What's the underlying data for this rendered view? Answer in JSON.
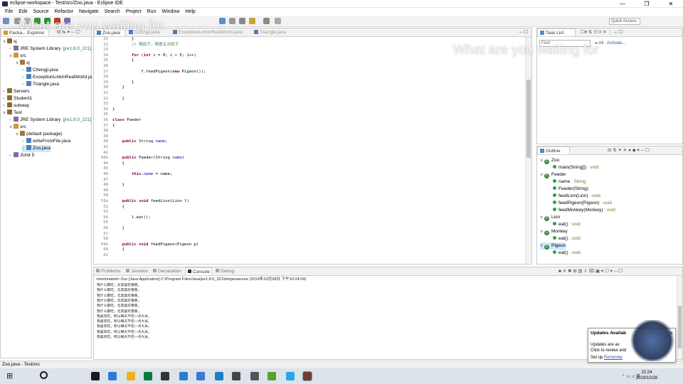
{
  "window": {
    "title": "eclipse-workspace - Test/src/Zoo.java - Eclipse IDE",
    "min": "—",
    "max": "❐",
    "close": "✕"
  },
  "menu": [
    "File",
    "Edit",
    "Source",
    "Refactor",
    "Navigate",
    "Search",
    "Project",
    "Run",
    "Window",
    "Help"
  ],
  "toolbar": {
    "quick_access": "Quick Access"
  },
  "package_explorer": {
    "tab_label": "Packa... Explorer",
    "rows": [
      {
        "indent": 0,
        "twisty": "∨",
        "icon": "project-icon",
        "label": "sj",
        "color": "#8a6d2e"
      },
      {
        "indent": 1,
        "twisty": "›",
        "icon": "library-icon",
        "label": "JRE System Library",
        "deco": "[jre1.8.0_221]",
        "color": "#7d6da8"
      },
      {
        "indent": 1,
        "twisty": "∨",
        "icon": "source-folder-icon",
        "label": "src",
        "color": "#c79a3a"
      },
      {
        "indent": 2,
        "twisty": "∨",
        "icon": "package-icon",
        "label": "sj",
        "color": "#a5763a"
      },
      {
        "indent": 3,
        "twisty": "›",
        "icon": "java-file-icon",
        "label": "Chengji.java",
        "color": "#4a7fbf"
      },
      {
        "indent": 3,
        "twisty": "›",
        "icon": "java-file-icon",
        "label": "ExceptionLinkInRealWorld.ja",
        "color": "#4a7fbf"
      },
      {
        "indent": 3,
        "twisty": "›",
        "icon": "java-file-icon",
        "label": "Triangle.java",
        "color": "#4a7fbf"
      },
      {
        "indent": 0,
        "twisty": "›",
        "icon": "project-icon",
        "label": "Servers",
        "color": "#8a6d2e"
      },
      {
        "indent": 0,
        "twisty": "›",
        "icon": "project-icon",
        "label": "Student1",
        "color": "#8a6d2e"
      },
      {
        "indent": 0,
        "twisty": "›",
        "icon": "project-icon",
        "label": "subway",
        "color": "#8a6d2e"
      },
      {
        "indent": 0,
        "twisty": "∨",
        "icon": "project-icon",
        "label": "Test",
        "color": "#8a6d2e"
      },
      {
        "indent": 1,
        "twisty": "›",
        "icon": "library-icon",
        "label": "JRE System Library",
        "deco": "[jre1.8.0_221]",
        "color": "#7d6da8"
      },
      {
        "indent": 1,
        "twisty": "∨",
        "icon": "source-folder-icon",
        "label": "src",
        "color": "#c79a3a"
      },
      {
        "indent": 2,
        "twisty": "∨",
        "icon": "package-icon",
        "label": "(default package)",
        "color": "#a5763a"
      },
      {
        "indent": 3,
        "twisty": "›",
        "icon": "java-file-icon",
        "label": "writeFromFile.java",
        "color": "#4a7fbf"
      },
      {
        "indent": 3,
        "twisty": "›",
        "icon": "java-file-icon",
        "label": "Zoo.java",
        "color": "#4a7fbf",
        "selected": true
      },
      {
        "indent": 1,
        "twisty": "›",
        "icon": "library-icon",
        "label": "JUnit 5",
        "color": "#7d6da8"
      }
    ]
  },
  "editor": {
    "tabs": [
      {
        "label": "Zoo.java",
        "active": true
      },
      {
        "label": "Chengji.java"
      },
      {
        "label": "ExceptionLinkInRealWorld.java"
      },
      {
        "label": "Triangle.java"
      }
    ],
    "lines": [
      {
        "n": "21",
        "t": "        }"
      },
      {
        "n": "22",
        "t": "        // 喂鸽子，喂食五次鸽子"
      },
      {
        "n": "23",
        "t": ""
      },
      {
        "n": "24",
        "t": "        for (int i = 0; i < 5; i++)"
      },
      {
        "n": "25",
        "t": "        {"
      },
      {
        "n": "26",
        "t": ""
      },
      {
        "n": "27",
        "t": "            f.feedPigeon(new Pigeon());"
      },
      {
        "n": "28",
        "t": ""
      },
      {
        "n": "29",
        "t": "        }"
      },
      {
        "n": "30",
        "t": "    }"
      },
      {
        "n": "31",
        "t": ""
      },
      {
        "n": "32",
        "t": "    }"
      },
      {
        "n": "33",
        "t": ""
      },
      {
        "n": "34",
        "t": "}"
      },
      {
        "n": "35",
        "t": ""
      },
      {
        "n": "36",
        "t": "class Feeder"
      },
      {
        "n": "37",
        "t": "{"
      },
      {
        "n": "38",
        "t": ""
      },
      {
        "n": "39",
        "t": ""
      },
      {
        "n": "40",
        "t": "    public String name;"
      },
      {
        "n": "41",
        "t": ""
      },
      {
        "n": "42",
        "t": ""
      },
      {
        "n": "43⊖",
        "t": "    public Feeder(String name)"
      },
      {
        "n": "44",
        "t": "    {"
      },
      {
        "n": "45",
        "t": ""
      },
      {
        "n": "46",
        "t": "        this.name = name;"
      },
      {
        "n": "47",
        "t": ""
      },
      {
        "n": "48",
        "t": "    }"
      },
      {
        "n": "49",
        "t": ""
      },
      {
        "n": "50",
        "t": ""
      },
      {
        "n": "51⊖",
        "t": "    public void feedLion(Lion l)"
      },
      {
        "n": "52",
        "t": "    {"
      },
      {
        "n": "53",
        "t": ""
      },
      {
        "n": "54",
        "t": "        l.eat();"
      },
      {
        "n": "55",
        "t": ""
      },
      {
        "n": "56",
        "t": "    }"
      },
      {
        "n": "57",
        "t": ""
      },
      {
        "n": "58",
        "t": ""
      },
      {
        "n": "59⊖",
        "t": "    public void feedPigeon(Pigeon p)"
      },
      {
        "n": "60",
        "t": "    {"
      },
      {
        "n": "61",
        "t": ""
      }
    ]
  },
  "task_list": {
    "tab_label": "Task List",
    "find_placeholder": "Find",
    "all_label": "All",
    "activate_label": "Activate..."
  },
  "outline": {
    "tab_label": "Outline",
    "rows": [
      {
        "indent": 0,
        "kind": "class",
        "label": "Zoo"
      },
      {
        "indent": 1,
        "kind": "method",
        "label": "main(String[])",
        "type": " : void"
      },
      {
        "indent": 0,
        "kind": "class",
        "label": "Feeder"
      },
      {
        "indent": 1,
        "kind": "field",
        "label": "name",
        "type": " : String"
      },
      {
        "indent": 1,
        "kind": "method",
        "label": "Feeder(String)",
        "type": ""
      },
      {
        "indent": 1,
        "kind": "method",
        "label": "feedLion(Lion)",
        "type": " : void"
      },
      {
        "indent": 1,
        "kind": "method",
        "label": "feedPigeon(Pigeon)",
        "type": " : void"
      },
      {
        "indent": 1,
        "kind": "method",
        "label": "feedMonkey(Monkey)",
        "type": " : void"
      },
      {
        "indent": 0,
        "kind": "class",
        "label": "Lion"
      },
      {
        "indent": 1,
        "kind": "method",
        "label": "eat()",
        "type": " : void"
      },
      {
        "indent": 0,
        "kind": "class",
        "label": "Monkey"
      },
      {
        "indent": 1,
        "kind": "method",
        "label": "eat()",
        "type": " : void"
      },
      {
        "indent": 0,
        "kind": "class",
        "label": "Pigeon",
        "selected": true
      },
      {
        "indent": 1,
        "kind": "method",
        "label": "eat()",
        "type": " : void"
      }
    ]
  },
  "bottom_tabs": [
    "Problems",
    "Javadoc",
    "Declaration",
    "Console",
    "Debug"
  ],
  "console": {
    "header": "<terminated> Zoo [Java Application] C:\\Program Files\\Java\\jre1.8.0_221\\bin\\javaw.exe (2019年10月28日 下午10:24:04)",
    "lines": [
      "我什么都吃，尤其喜欢香蕉。",
      "我什么都吃，尤其喜欢香蕉。",
      "我什么都吃，尤其喜欢香蕉。",
      "我什么都吃，尤其喜欢香蕉。",
      "我什么都吃，尤其喜欢香蕉。",
      "我什么都吃，尤其喜欢香蕉。",
      "我喜欢吃，所以每天不吃一点大米。",
      "我喜欢吃，所以每天不吃一点大米。",
      "我喜欢吃，所以每天不吃一点大米。",
      "我喜欢吃，所以每天不吃一点大米。",
      "我喜欢吃，所以每天不吃一点大米。"
    ]
  },
  "status": {
    "text": "Zoo.java - Test/src"
  },
  "popup": {
    "title": "Updates Availab",
    "line1": "Updates are av",
    "line2": "Click to review and",
    "line3": "Set up",
    "reminder": "Reminder",
    "close": "×"
  },
  "watermark": "What are you waiting for",
  "taskbar": {
    "time": "22:24",
    "date": "2019/10/28"
  }
}
